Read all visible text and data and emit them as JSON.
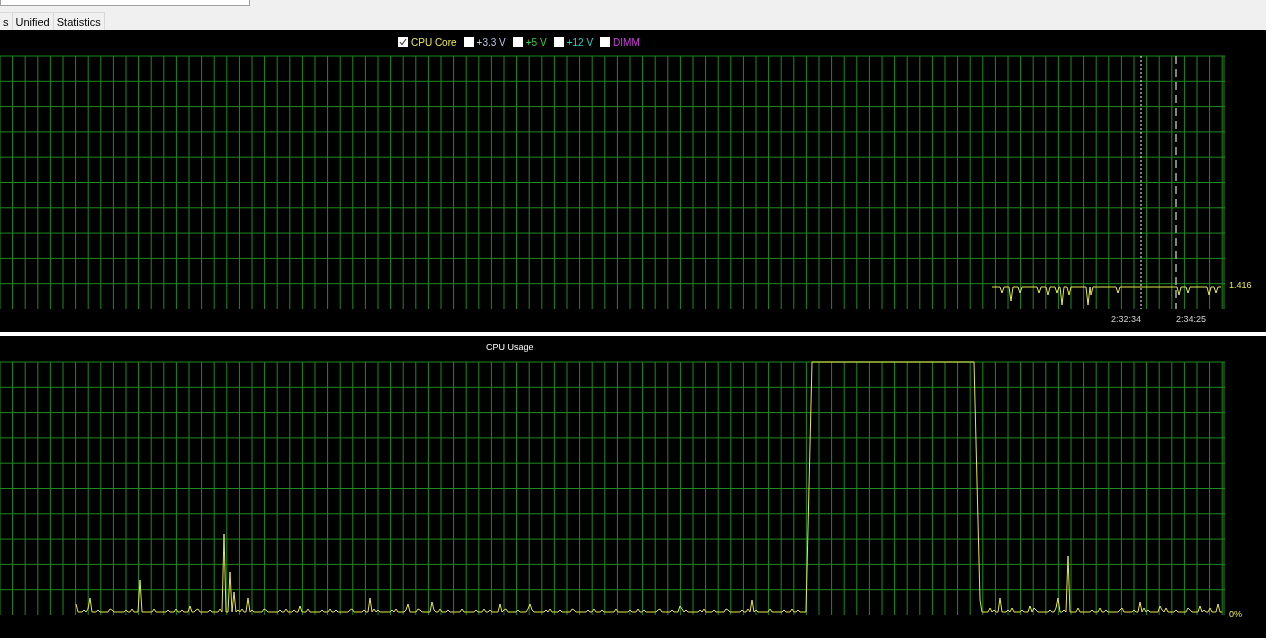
{
  "tabs": [
    {
      "label": "s"
    },
    {
      "label": "Unified"
    },
    {
      "label": "Statistics"
    }
  ],
  "voltage_chart": {
    "legend": [
      {
        "label": "CPU Core",
        "checked": true,
        "color": "#e8e84a"
      },
      {
        "label": "+3.3 V",
        "checked": false,
        "color": "#b8c8e8"
      },
      {
        "label": "+5 V",
        "checked": false,
        "color": "#3ccf3c"
      },
      {
        "label": "+12 V",
        "checked": false,
        "color": "#2fd2c8"
      },
      {
        "label": "DIMM",
        "checked": false,
        "color": "#d040e0"
      }
    ],
    "value_label": "1.416",
    "time_labels": [
      "2:32:34",
      "2:34:25"
    ]
  },
  "cpu_chart": {
    "title": "CPU Usage",
    "value_label": "0%"
  }
}
